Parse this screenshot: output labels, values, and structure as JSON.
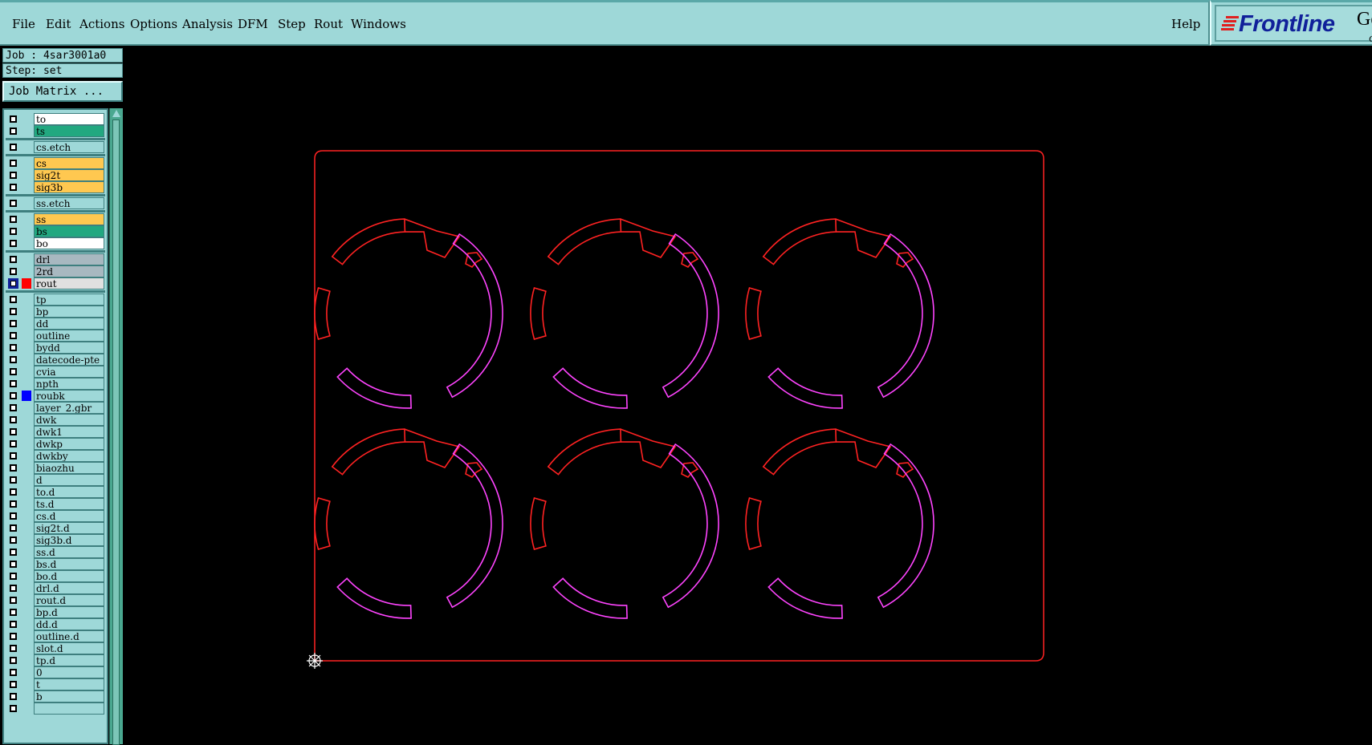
{
  "menu": {
    "items": [
      "File",
      "Edit",
      "Actions",
      "Options",
      "Analysis",
      "DFM",
      "Step",
      "Rout",
      "Windows"
    ],
    "help": "Help"
  },
  "logo": {
    "text": "Frontline",
    "sub1": "Ge",
    "sub2": "G"
  },
  "job": {
    "label": "Job : 4sar3001a0",
    "step": "Step: set",
    "matrix_button": "Job Matrix ..."
  },
  "colors": {
    "board_type": "#22a880",
    "signal": "#ffc850",
    "drill": "#a8b8c0",
    "misc": "#9ed8d8",
    "white": "#ffffff",
    "active": "#e0e0e0",
    "red": "#ff2222",
    "magenta": "#ff44ff",
    "outline": "#ff2222",
    "background": "#000000"
  },
  "layers": [
    {
      "name": "to",
      "color": "#ffffff",
      "swatch": ""
    },
    {
      "name": "ts",
      "color": "#22a880",
      "swatch": ""
    },
    {
      "name": "cs.etch",
      "color": "#9ed8d8",
      "swatch": ""
    },
    {
      "name": "cs",
      "color": "#ffc850",
      "swatch": ""
    },
    {
      "name": "sig2t",
      "color": "#ffc850",
      "swatch": ""
    },
    {
      "name": "sig3b",
      "color": "#ffc850",
      "swatch": ""
    },
    {
      "name": "ss.etch",
      "color": "#9ed8d8",
      "swatch": ""
    },
    {
      "name": "ss",
      "color": "#ffc850",
      "swatch": ""
    },
    {
      "name": "bs",
      "color": "#22a880",
      "swatch": ""
    },
    {
      "name": "bo",
      "color": "#ffffff",
      "swatch": ""
    },
    {
      "name": "drl",
      "color": "#a8b8c0",
      "swatch": ""
    },
    {
      "name": "2rd",
      "color": "#a8b8c0",
      "swatch": ""
    },
    {
      "name": "rout",
      "color": "#e0e0e0",
      "swatch": "#ff0000",
      "active": true
    },
    {
      "name": "tp",
      "color": "#9ed8d8",
      "swatch": ""
    },
    {
      "name": "bp",
      "color": "#9ed8d8",
      "swatch": ""
    },
    {
      "name": "dd",
      "color": "#9ed8d8",
      "swatch": ""
    },
    {
      "name": "outline",
      "color": "#9ed8d8",
      "swatch": ""
    },
    {
      "name": "bydd",
      "color": "#9ed8d8",
      "swatch": ""
    },
    {
      "name": "datecode-pte",
      "color": "#9ed8d8",
      "swatch": ""
    },
    {
      "name": "cvia",
      "color": "#9ed8d8",
      "swatch": ""
    },
    {
      "name": "npth",
      "color": "#9ed8d8",
      "swatch": ""
    },
    {
      "name": "roubk",
      "color": "#9ed8d8",
      "swatch": "#0000ff"
    },
    {
      "name": "layer_2.gbr",
      "color": "#9ed8d8",
      "swatch": ""
    },
    {
      "name": "dwk",
      "color": "#9ed8d8",
      "swatch": ""
    },
    {
      "name": "dwk1",
      "color": "#9ed8d8",
      "swatch": ""
    },
    {
      "name": "dwkp",
      "color": "#9ed8d8",
      "swatch": ""
    },
    {
      "name": "dwkby",
      "color": "#9ed8d8",
      "swatch": ""
    },
    {
      "name": "biaozhu",
      "color": "#9ed8d8",
      "swatch": ""
    },
    {
      "name": "d",
      "color": "#9ed8d8",
      "swatch": ""
    },
    {
      "name": "to.d",
      "color": "#9ed8d8",
      "swatch": ""
    },
    {
      "name": "ts.d",
      "color": "#9ed8d8",
      "swatch": ""
    },
    {
      "name": "cs.d",
      "color": "#9ed8d8",
      "swatch": ""
    },
    {
      "name": "sig2t.d",
      "color": "#9ed8d8",
      "swatch": ""
    },
    {
      "name": "sig3b.d",
      "color": "#9ed8d8",
      "swatch": ""
    },
    {
      "name": "ss.d",
      "color": "#9ed8d8",
      "swatch": ""
    },
    {
      "name": "bs.d",
      "color": "#9ed8d8",
      "swatch": ""
    },
    {
      "name": "bo.d",
      "color": "#9ed8d8",
      "swatch": ""
    },
    {
      "name": "drl.d",
      "color": "#9ed8d8",
      "swatch": ""
    },
    {
      "name": "rout.d",
      "color": "#9ed8d8",
      "swatch": ""
    },
    {
      "name": "bp.d",
      "color": "#9ed8d8",
      "swatch": ""
    },
    {
      "name": "dd.d",
      "color": "#9ed8d8",
      "swatch": ""
    },
    {
      "name": "outline.d",
      "color": "#9ed8d8",
      "swatch": ""
    },
    {
      "name": "slot.d",
      "color": "#9ed8d8",
      "swatch": ""
    },
    {
      "name": "tp.d",
      "color": "#9ed8d8",
      "swatch": ""
    },
    {
      "name": "0",
      "color": "#9ed8d8",
      "swatch": ""
    },
    {
      "name": "t",
      "color": "#9ed8d8",
      "swatch": ""
    },
    {
      "name": "b",
      "color": "#9ed8d8",
      "swatch": ""
    },
    {
      "name": "",
      "color": "#9ed8d8",
      "swatch": ""
    }
  ]
}
